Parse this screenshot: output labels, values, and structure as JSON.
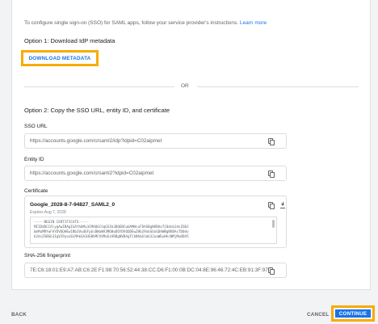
{
  "intro": {
    "text": "To configure single sign-on (SSO) for SAML apps, follow your service provider's instructions.",
    "link": "Learn more"
  },
  "option1": {
    "title": "Option 1: Download IdP metadata",
    "button": "DOWNLOAD METADATA"
  },
  "divider": {
    "text": "OR"
  },
  "option2": {
    "title": "Option 2: Copy the SSO URL, entity ID, and certificate",
    "sso_url_label": "SSO URL",
    "sso_url_value": "https://accounts.google.com/o/saml2/idp?idpid=C02aipmet",
    "entity_id_label": "Entity ID",
    "entity_id_value": "https://accounts.google.com/o/saml2?idpid=C02aipmet",
    "certificate_label": "Certificate",
    "certificate": {
      "name": "Google_2028-8-7-94827_SAML2_0",
      "expires": "Expires Aug 7, 2028",
      "lines": [
        "-----BEGIN CERTIFICATE-----",
        "MIIDdDCCAlygAwIBAgIGAYhbMx3CMA0GCSqGSIb3DQEBCwUAMHsxFDASBgNVBAoTC0dvb2dsZSBJ",
        "bmMuMRYwFAYDVQQHEw1Nb3VudGFpbiBWaWV3MQ8wDQYDVQQDEwZHb29nbGUxGDAWBgNVBAsTD0dv",
        "b2dsZSBGb3IgV29yazELMAkGA1UEBhMCVVMxEzARBgNVBAgTCkNhbGlmb3JuaWEwHhcNMjMwODA5"
      ]
    },
    "fingerprint_label": "SHA-256 fingerprint",
    "fingerprint_value": "7E:C6:18:01:E9:A7:AB:C6:2E:F1:98:70:56:52:44:38:CC:D6:F1:00:0B:DC:04:8E:96:46:72:4C:EB:91:3F:97"
  },
  "footer": {
    "back": "BACK",
    "cancel": "CANCEL",
    "continue": "CONTINUE"
  },
  "colors": {
    "accent": "#1a73e8",
    "highlight": "#f9ab00"
  }
}
